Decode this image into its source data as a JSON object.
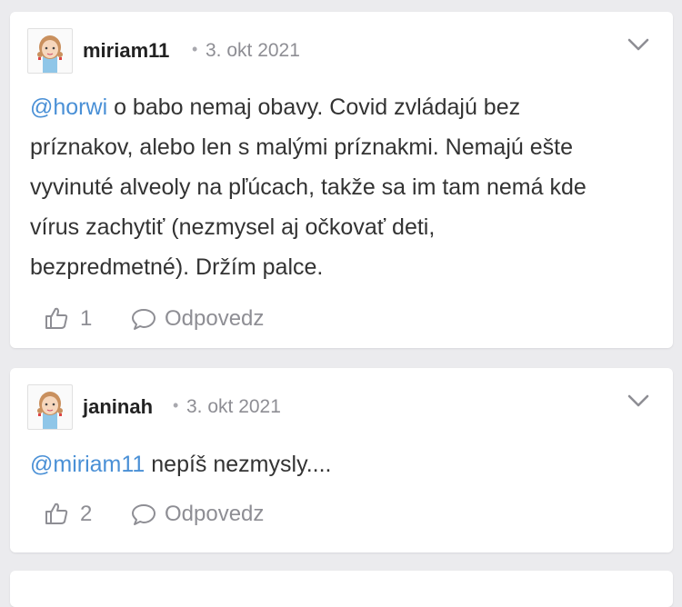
{
  "comments": [
    {
      "author": "miriam11",
      "separator": "•",
      "date": "3. okt 2021",
      "mention": "@horwi",
      "lines": [
        " o babo nemaj obavy. Covid zvládajú bez",
        "príznakov, alebo len s malými príznakmi. Nemajú ešte",
        "vyvinuté alveoly na pľúcach, takže sa im tam nemá kde",
        "vírus zachytiť (nezmysel aj očkovať deti,",
        "bezpredmetné). Držím palce."
      ],
      "likes": "1",
      "reply_label": "Odpovedz"
    },
    {
      "author": "janinah",
      "separator": "•",
      "date": "3. okt 2021",
      "mention": "@miriam11",
      "lines": [
        " nepíš nezmysly...."
      ],
      "likes": "2",
      "reply_label": "Odpovedz"
    }
  ],
  "icons": {
    "like": "thumbs-up-icon",
    "reply": "speech-bubble-icon",
    "menu": "chevron-down-icon",
    "avatar": "girl-avatar"
  },
  "colors": {
    "mention": "#4a90d6",
    "muted": "#8e8e94",
    "background": "#ebebee",
    "card": "#ffffff"
  }
}
